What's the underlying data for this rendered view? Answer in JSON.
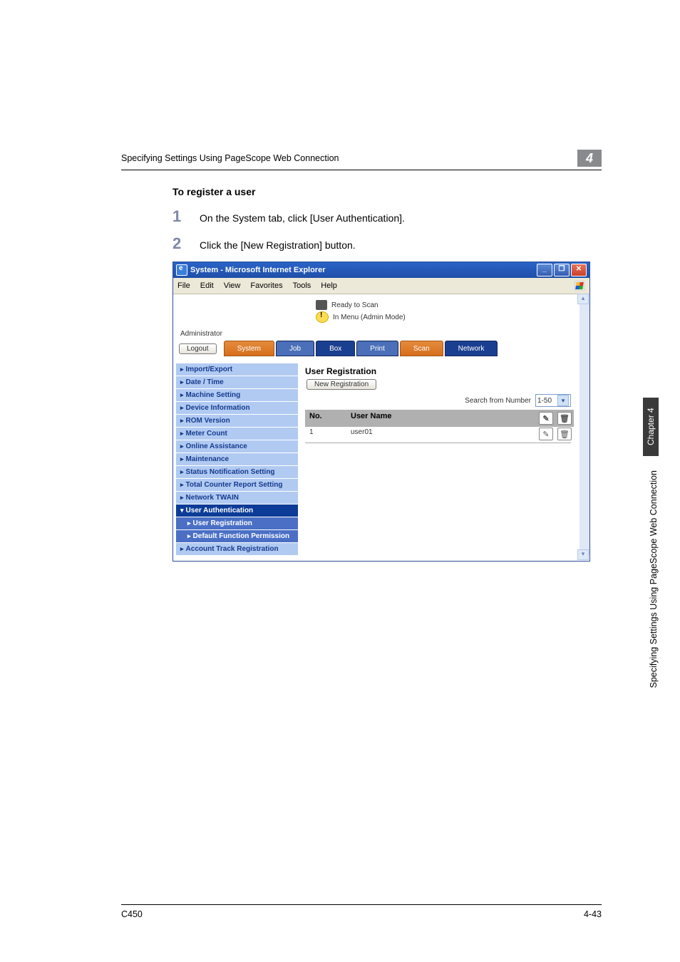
{
  "page": {
    "header_line": "Specifying Settings Using PageScope Web Connection",
    "header_badge": "4",
    "section_title": "To register a user",
    "steps": [
      {
        "num": "1",
        "text": "On the System tab, click [User Authentication]."
      },
      {
        "num": "2",
        "text": "Click the [New Registration] button."
      }
    ],
    "footer_left": "C450",
    "footer_right": "4-43",
    "side_tab": "Chapter 4",
    "side_text": "Specifying Settings Using PageScope Web Connection"
  },
  "ie": {
    "title": "System - Microsoft Internet Explorer",
    "menus": [
      "File",
      "Edit",
      "View",
      "Favorites",
      "Tools",
      "Help"
    ],
    "win_min": "_",
    "win_max": "❐",
    "win_close": "✕",
    "status_ready": "Ready to Scan",
    "status_menu": "In Menu (Admin Mode)",
    "administrator": "Administrator",
    "logout": "Logout",
    "tabs": {
      "system": "System",
      "job": "Job",
      "box": "Box",
      "print": "Print",
      "scan": "Scan",
      "network": "Network"
    },
    "sidebar": [
      "Import/Export",
      "Date / Time",
      "Machine Setting",
      "Device Information",
      "ROM Version",
      "Meter Count",
      "Online Assistance",
      "Maintenance",
      "Status Notification Setting",
      "Total Counter Report Setting",
      "Network TWAIN"
    ],
    "sidebar_dark": "User Authentication",
    "sidebar_sub": [
      "User Registration",
      "Default Function Permission"
    ],
    "sidebar_after": "Account Track Registration",
    "pane": {
      "title": "User Registration",
      "new_registration": "New Registration",
      "search_label": "Search from Number",
      "search_value": "1-50",
      "columns": {
        "no": "No.",
        "user": "User Name"
      },
      "icons_head": {
        "edit": "✎",
        "del": "🗑"
      },
      "rows": [
        {
          "no": "1",
          "user": "user01",
          "edit": "✎",
          "del": "🗑"
        }
      ]
    },
    "scroll_up": "▴",
    "scroll_down": "▾"
  }
}
